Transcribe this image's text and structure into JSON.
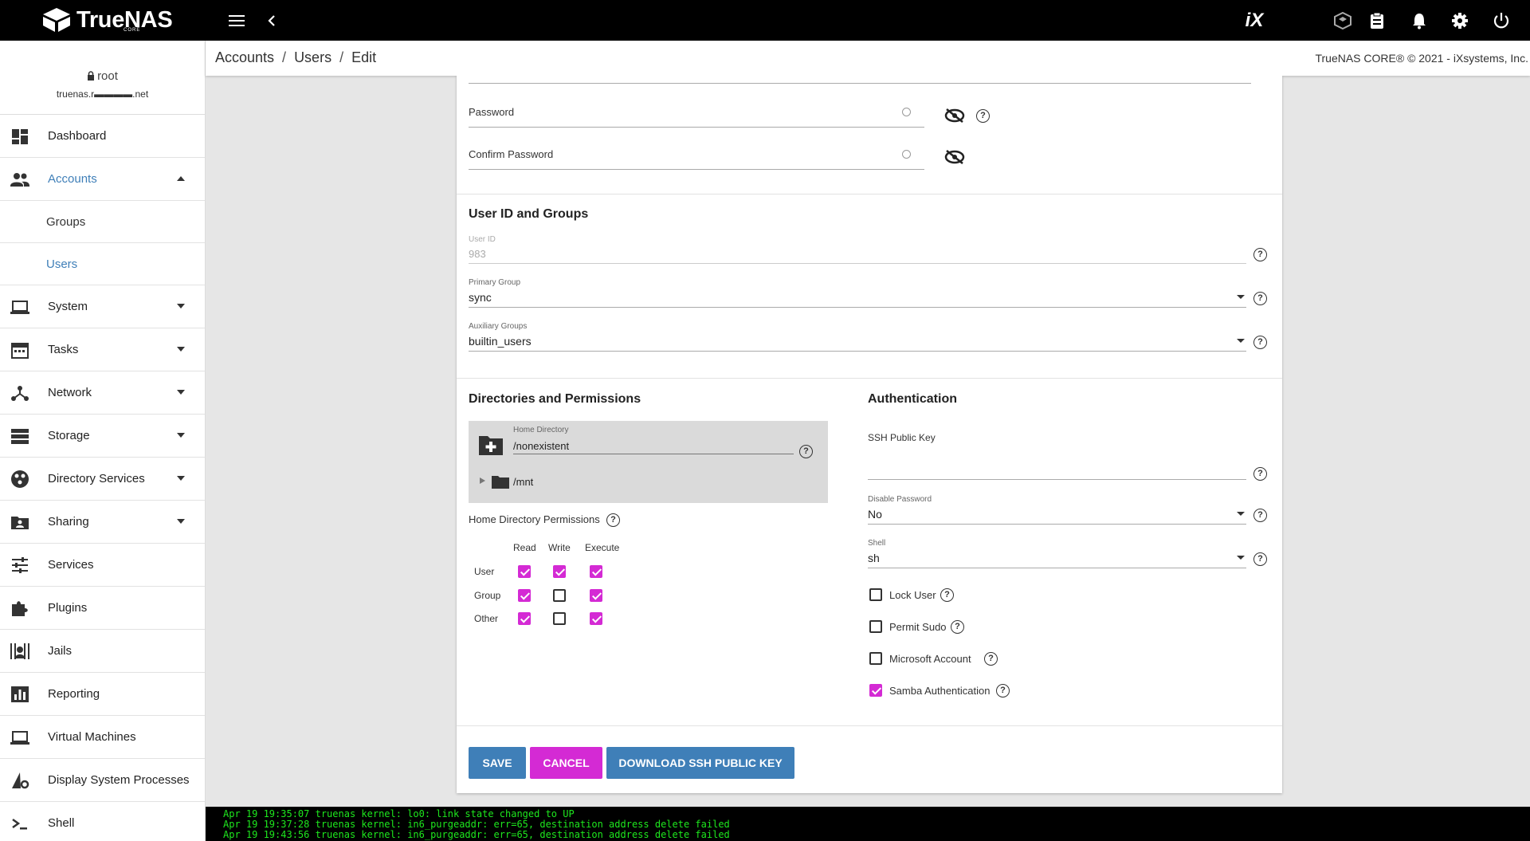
{
  "topbar": {
    "logo_text": "TrueNAS",
    "logo_sub": "CORE",
    "ix_logo": "iX"
  },
  "sidebar": {
    "user": "root",
    "host": "truenas.r▬▬▬▬.net",
    "items": [
      {
        "label": "Dashboard",
        "icon": "dashboard-icon"
      },
      {
        "label": "Accounts",
        "icon": "people-icon"
      },
      {
        "label": "System",
        "icon": "laptop-icon"
      },
      {
        "label": "Tasks",
        "icon": "calendar-icon"
      },
      {
        "label": "Network",
        "icon": "network-icon"
      },
      {
        "label": "Storage",
        "icon": "storage-icon"
      },
      {
        "label": "Directory Services",
        "icon": "directory-services-icon"
      },
      {
        "label": "Sharing",
        "icon": "sharing-icon"
      },
      {
        "label": "Services",
        "icon": "tune-icon"
      },
      {
        "label": "Plugins",
        "icon": "puzzle-icon"
      },
      {
        "label": "Jails",
        "icon": "jail-icon"
      },
      {
        "label": "Reporting",
        "icon": "chart-icon"
      },
      {
        "label": "Virtual Machines",
        "icon": "laptop-icon"
      },
      {
        "label": "Display System Processes",
        "icon": "processes-icon"
      },
      {
        "label": "Shell",
        "icon": "shell-icon"
      }
    ],
    "sub_items": [
      "Groups",
      "Users"
    ]
  },
  "breadcrumb": {
    "items": [
      "Accounts",
      "Users",
      "Edit"
    ],
    "copyright": "TrueNAS CORE® © 2021 - iXsystems, Inc."
  },
  "form": {
    "password_label": "Password",
    "confirm_password_label": "Confirm Password",
    "uid_section": "User ID and Groups",
    "user_id_label": "User ID",
    "user_id_value": "983",
    "primary_group_label": "Primary Group",
    "primary_group_value": "sync",
    "aux_groups_label": "Auxiliary Groups",
    "aux_groups_value": "builtin_users",
    "dirs_section": "Directories and Permissions",
    "home_dir_label": "Home Directory",
    "home_dir_value": "/nonexistent",
    "tree_node": "/mnt",
    "home_perm_label": "Home Directory Permissions",
    "perm_cols": [
      "Read",
      "Write",
      "Execute"
    ],
    "perm_rows": [
      {
        "label": "User",
        "read": true,
        "write": true,
        "execute": true
      },
      {
        "label": "Group",
        "read": true,
        "write": false,
        "execute": true
      },
      {
        "label": "Other",
        "read": true,
        "write": false,
        "execute": true
      }
    ],
    "auth_section": "Authentication",
    "ssh_key_label": "SSH Public Key",
    "disable_password_label": "Disable Password",
    "disable_password_value": "No",
    "shell_label": "Shell",
    "shell_value": "sh",
    "lock_user": "Lock User",
    "permit_sudo": "Permit Sudo",
    "microsoft_account": "Microsoft Account",
    "samba_auth": "Samba Authentication",
    "checks": {
      "lock_user": false,
      "permit_sudo": false,
      "microsoft_account": false,
      "samba_auth": true
    }
  },
  "buttons": {
    "save": "SAVE",
    "cancel": "CANCEL",
    "download": "DOWNLOAD SSH PUBLIC KEY"
  },
  "console": [
    "Apr 19 19:35:07 truenas kernel: lo0: link state changed to UP",
    "Apr 19 19:37:28 truenas kernel: in6_purgeaddr: err=65, destination address delete failed",
    "Apr 19 19:43:56 truenas kernel: in6_purgeaddr: err=65, destination address delete failed"
  ],
  "colors": {
    "accent_blue": "#3f7fb8",
    "accent_magenta": "#d42ad4",
    "topbar": "#000000",
    "console_text": "#1ee81e"
  }
}
